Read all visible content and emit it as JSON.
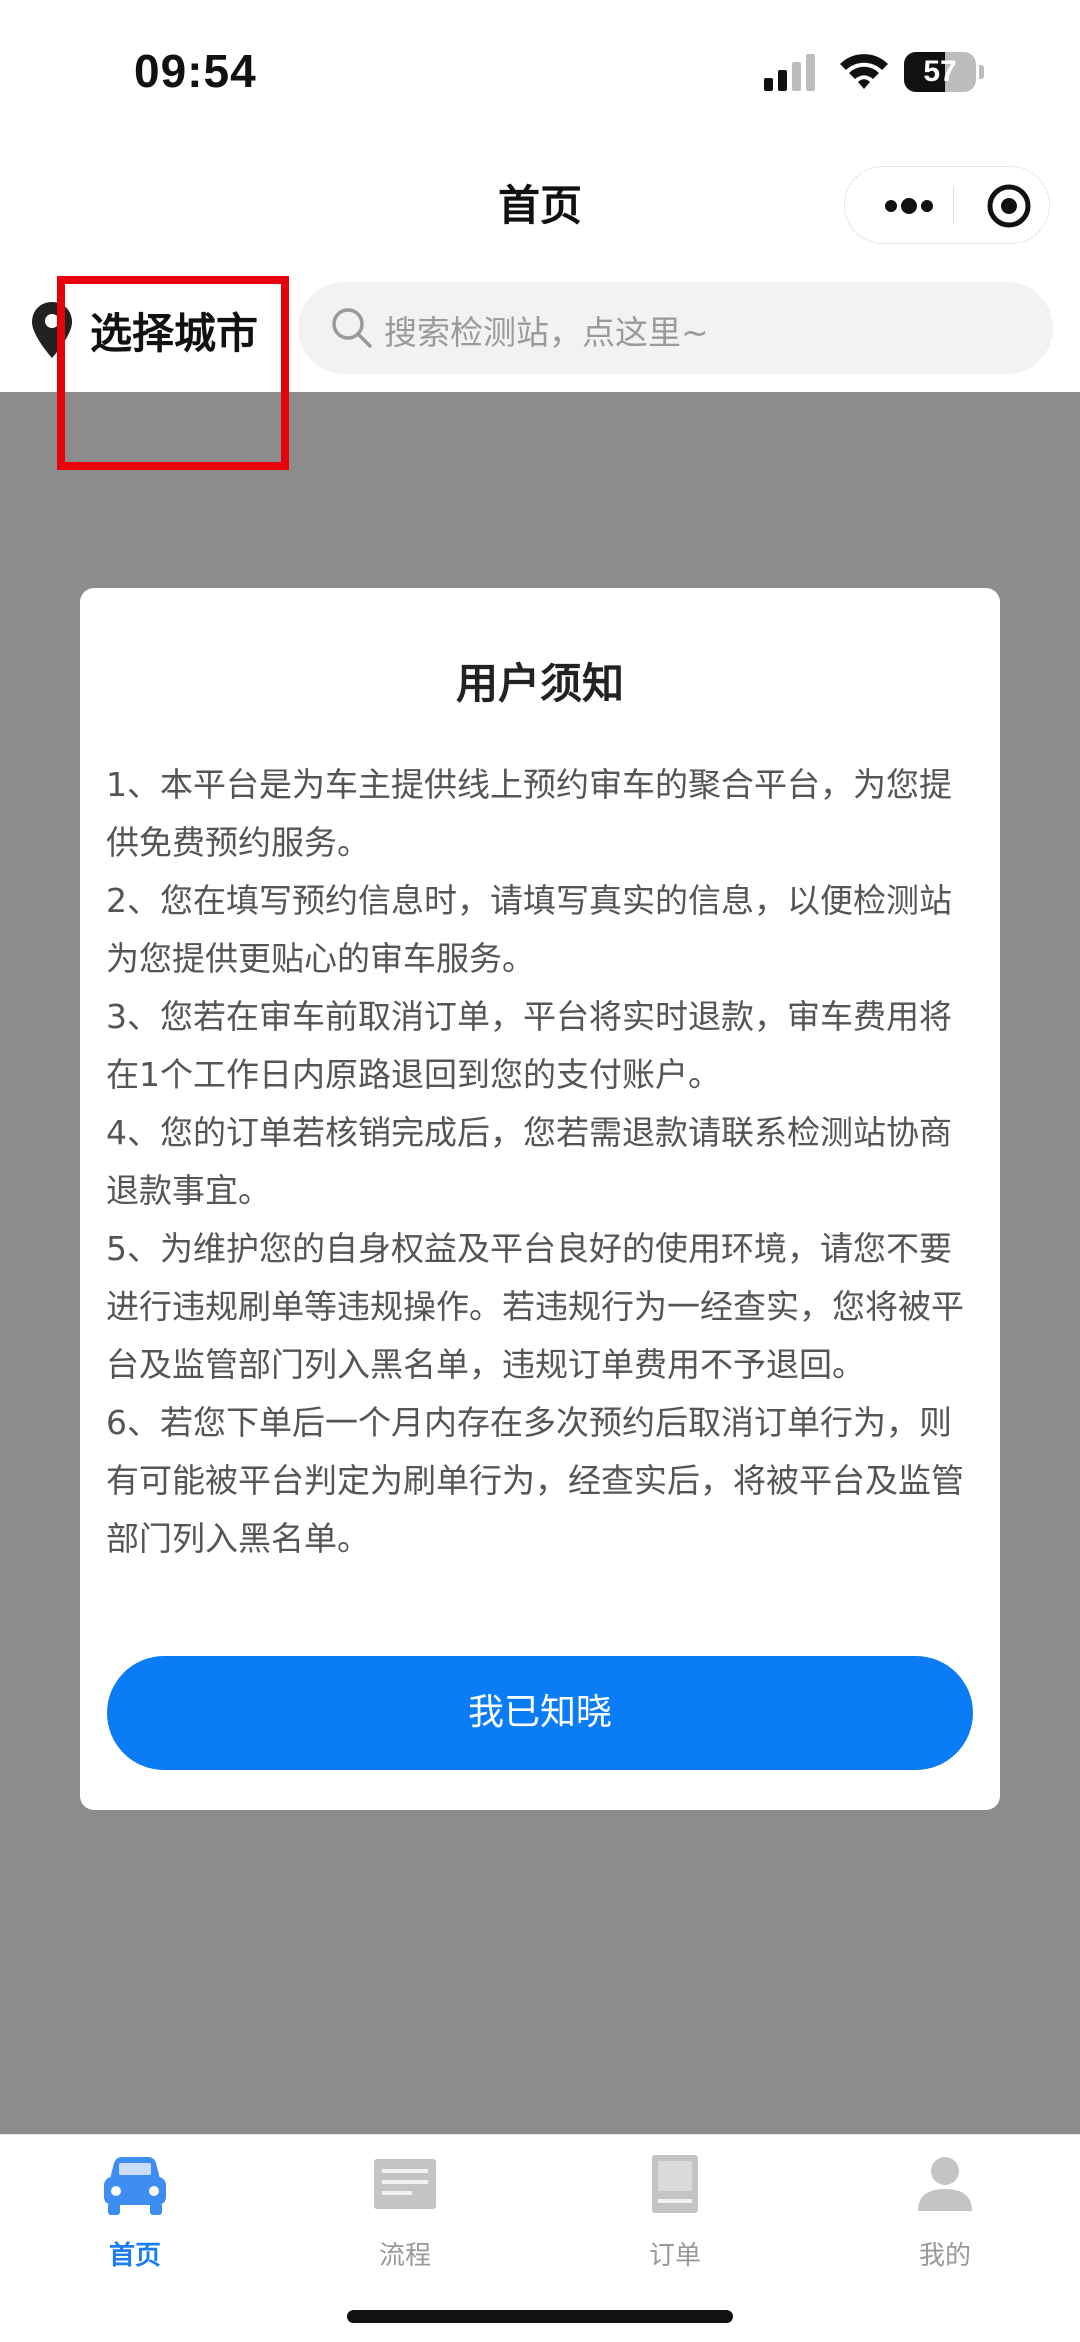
{
  "status_bar": {
    "time": "09:54",
    "battery": "57",
    "battery_level": 0.57
  },
  "nav": {
    "title": "首页"
  },
  "location": {
    "city_label": "选择城市"
  },
  "search": {
    "placeholder": "搜索检测站，点这里~"
  },
  "notice_modal": {
    "title": "用户须知",
    "items": [
      "1、本平台是为车主提供线上预约审车的聚合平台，为您提供免费预约服务。",
      "2、您在填写预约信息时，请填写真实的信息，以便检测站为您提供更贴心的审车服务。",
      "3、您若在审车前取消订单，平台将实时退款，审车费用将在1个工作日内原路退回到您的支付账户。",
      "4、您的订单若核销完成后，您若需退款请联系检测站协商退款事宜。",
      "5、为维护您的自身权益及平台良好的使用环境，请您不要进行违规刷单等违规操作。若违规行为一经查实，您将被平台及监管部门列入黑名单，违规订单费用不予退回。",
      "6、若您下单后一个月内存在多次预约后取消订单行为，则有可能被平台判定为刷单行为，经查实后，将被平台及监管部门列入黑名单。"
    ],
    "confirm_label": "我已知晓"
  },
  "tabbar": {
    "tabs": [
      {
        "label": "首页",
        "icon": "car-icon",
        "active": true
      },
      {
        "label": "流程",
        "icon": "process-icon",
        "active": false
      },
      {
        "label": "订单",
        "icon": "order-icon",
        "active": false
      },
      {
        "label": "我的",
        "icon": "profile-icon",
        "active": false
      }
    ]
  },
  "colors": {
    "primary": "#0a7cf5",
    "highlight_box": "#e8000b",
    "overlay": "#8c8c8c"
  }
}
